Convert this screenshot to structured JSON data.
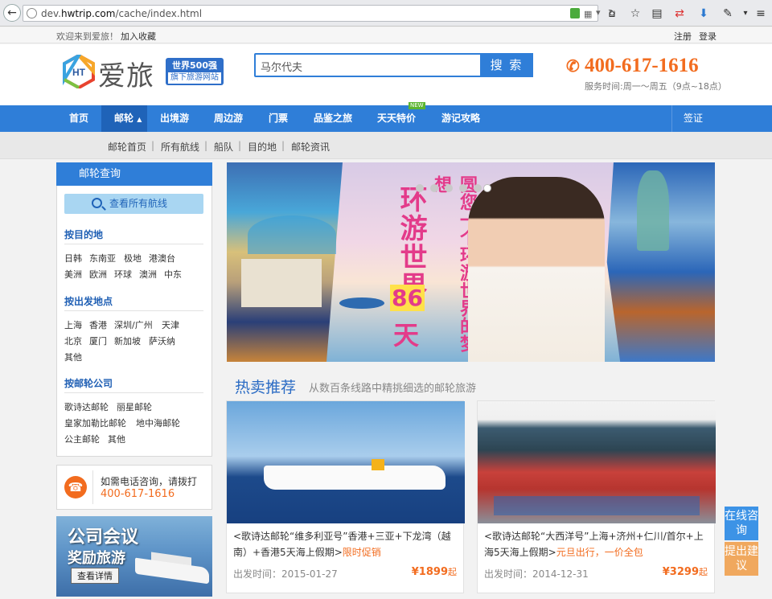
{
  "browser": {
    "url_prefix": "dev.",
    "url_host": "hwtrip.com",
    "url_path": "/cache/index.html"
  },
  "topbar": {
    "welcome": "欢迎来到爱旅！",
    "bookmark": "加入收藏",
    "register": "注册",
    "login": "登录"
  },
  "header": {
    "logo_mark": "HT",
    "logo_text": "爱旅",
    "badge_line1": "世界500强",
    "badge_line2": "旗下旅游网站",
    "search_value": "马尔代夫",
    "search_button": "搜 索",
    "phone": "400-617-1616",
    "hours": "服务时间:周一～周五（9点~18点）"
  },
  "nav": {
    "items": [
      "首页",
      "邮轮",
      "出境游",
      "周边游",
      "门票",
      "品鉴之旅",
      "天天特价",
      "游记攻略"
    ],
    "new_tag": "NEW",
    "visa": "签证"
  },
  "subnav": {
    "items": [
      "邮轮首页",
      "所有航线",
      "船队",
      "目的地",
      "邮轮资讯"
    ]
  },
  "sidebar": {
    "title": "邮轮查询",
    "all_routes": "查看所有航线",
    "by_destination": "按目的地",
    "destinations": [
      "日韩",
      "东南亚",
      "极地",
      "港澳台",
      "美洲",
      "欧洲",
      "环球",
      "澳洲",
      "中东"
    ],
    "by_departure": "按出发地点",
    "departures": [
      "上海",
      "香港",
      "深圳/广州",
      "天津",
      "北京",
      "厦门",
      "新加坡",
      "萨沃纳",
      "其他"
    ],
    "by_company": "按邮轮公司",
    "companies": [
      "歌诗达邮轮",
      "丽星邮轮",
      "皇家加勒比邮轮",
      "地中海邮轮",
      "公主邮轮",
      "其他"
    ]
  },
  "call": {
    "text": "如需电话咨询，请拨打",
    "number": "400-617-1616"
  },
  "promo": {
    "line1": "公司会议",
    "line2": "奖励旅游",
    "button": "查看详情"
  },
  "banner": {
    "title_a": "环游世界",
    "number": "86",
    "title_b": "天",
    "title_c": "圆您一个环游世界的梦想"
  },
  "hot": {
    "title": "热卖推荐",
    "subtitle": "从数百条线路中精挑细选的邮轮旅游",
    "cards": [
      {
        "title": "<歌诗达邮轮“维多利亚号”香港+三亚+下龙湾（越南）+香港5天海上假期>",
        "tag": "限时促销",
        "date": "出发时间：2015-01-27",
        "price": "¥1899",
        "price_unit": "起"
      },
      {
        "title": "<歌诗达邮轮“大西洋号”上海+济州+仁川/首尔+上海5天海上假期>",
        "tag": "元旦出行，一价全包",
        "date": "出发时间：2014-12-31",
        "price": "¥3299",
        "price_unit": "起"
      }
    ]
  },
  "float": {
    "consult": "在线咨询",
    "suggest": "提出建议"
  },
  "colors": {
    "brand_blue": "#2f7ed8",
    "accent_orange": "#f26c1f",
    "banner_pink": "#e33b8a"
  }
}
